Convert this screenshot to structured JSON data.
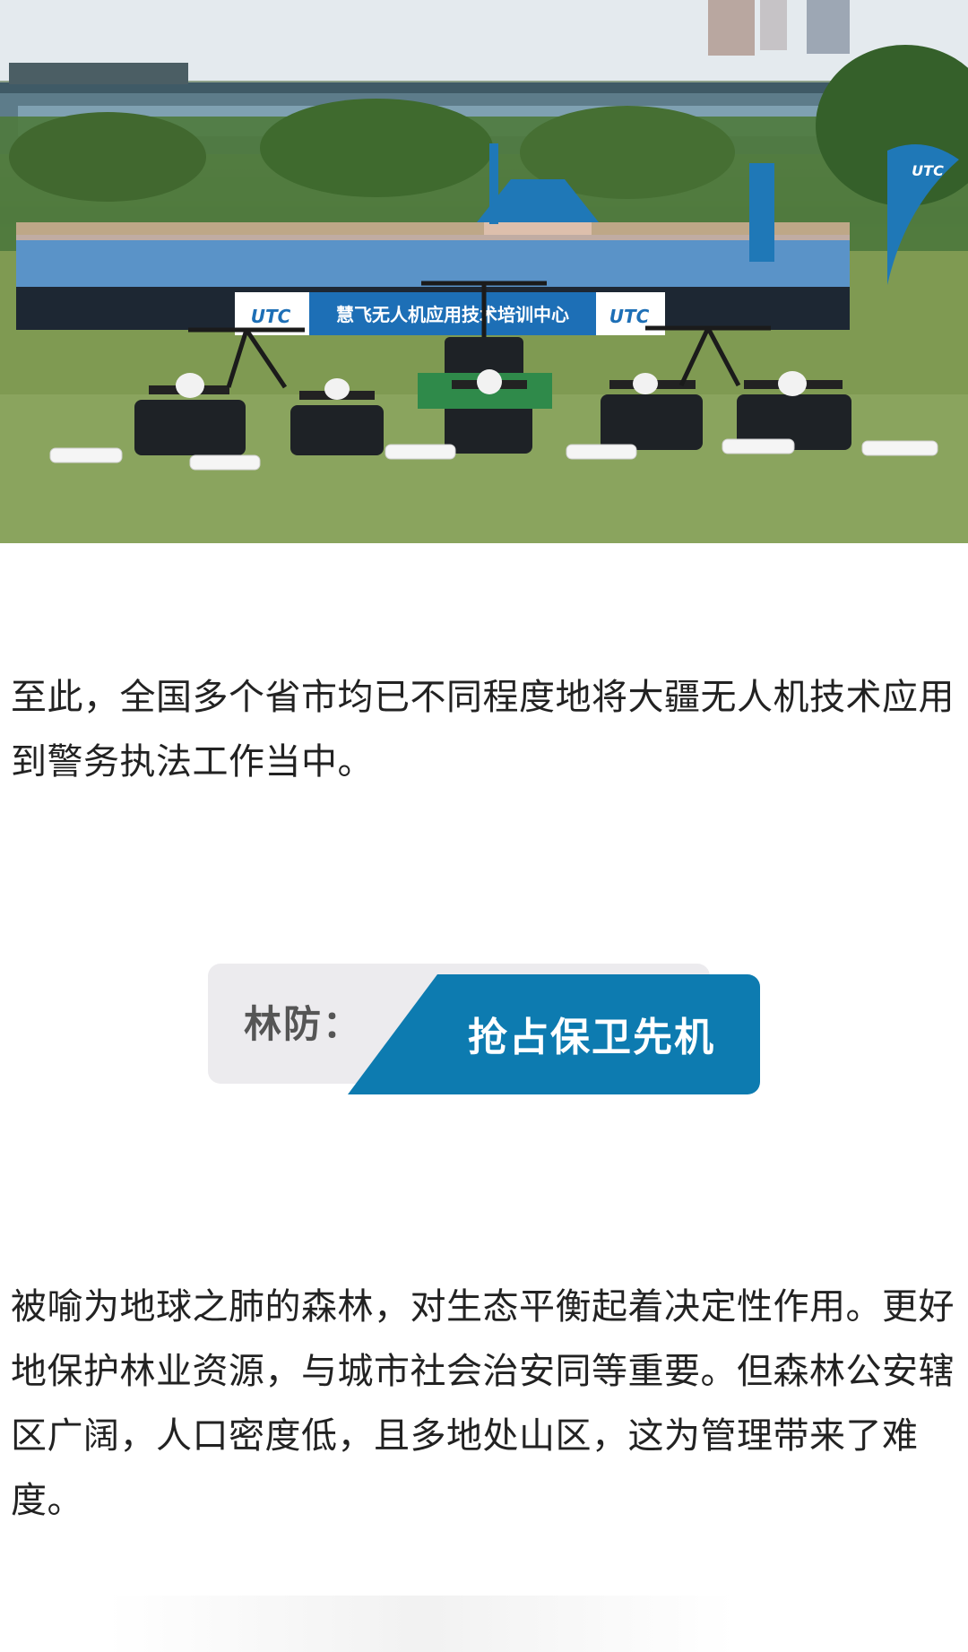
{
  "photo": {
    "banner_text": "慧飞无人机应用技术培训中心",
    "logo_text": "UTC",
    "flag_text": "UTC"
  },
  "paragraph_1": "至此，全国多个省市均已不同程度地将大疆无人机技术应用到警务执法工作当中。",
  "section": {
    "label": "林防：",
    "title": "抢占保卫先机",
    "accent_color": "#0d7bb0",
    "label_bg_color": "#ecebee"
  },
  "paragraph_2": "被喻为地球之肺的森林，对生态平衡起着决定性作用。更好地保护林业资源，与城市社会治安同等重要。但森林公安辖区广阔，人口密度低，且多地处山区，这为管理带来了难度。"
}
